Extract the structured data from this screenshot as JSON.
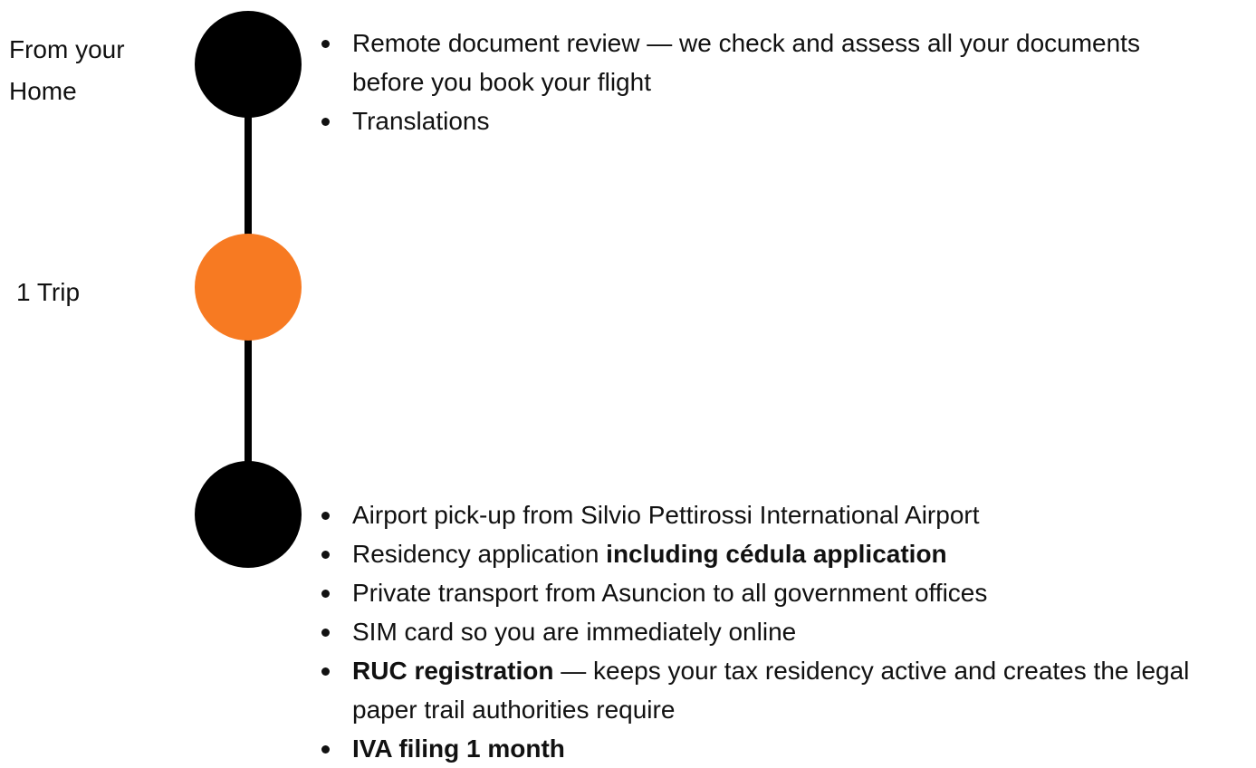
{
  "stages": [
    {
      "label": "From your Home",
      "node_color": "#000000",
      "items": [
        {
          "text": "Remote document review — we check and assess all your documents before you book your flight"
        },
        {
          "text": "Translations"
        }
      ]
    },
    {
      "label": "1 Trip",
      "node_color": "#f77a22",
      "items": []
    },
    {
      "label": "",
      "node_color": "#000000",
      "items": [
        {
          "text": "Airport pick-up from Silvio Pettirossi International Airport"
        },
        {
          "text": "Residency application ",
          "bold": "including cédula application"
        },
        {
          "text": "Private transport from Asuncion to all government offices"
        },
        {
          "text": "SIM card so you are immediately online"
        },
        {
          "bold": "RUC registration",
          "text": " — keeps your tax residency active and creates the legal paper trail authorities require"
        },
        {
          "bold": "IVA filing 1 month"
        }
      ]
    }
  ],
  "colors": {
    "line": "#000000",
    "accent": "#f77a22",
    "text": "#111111"
  }
}
